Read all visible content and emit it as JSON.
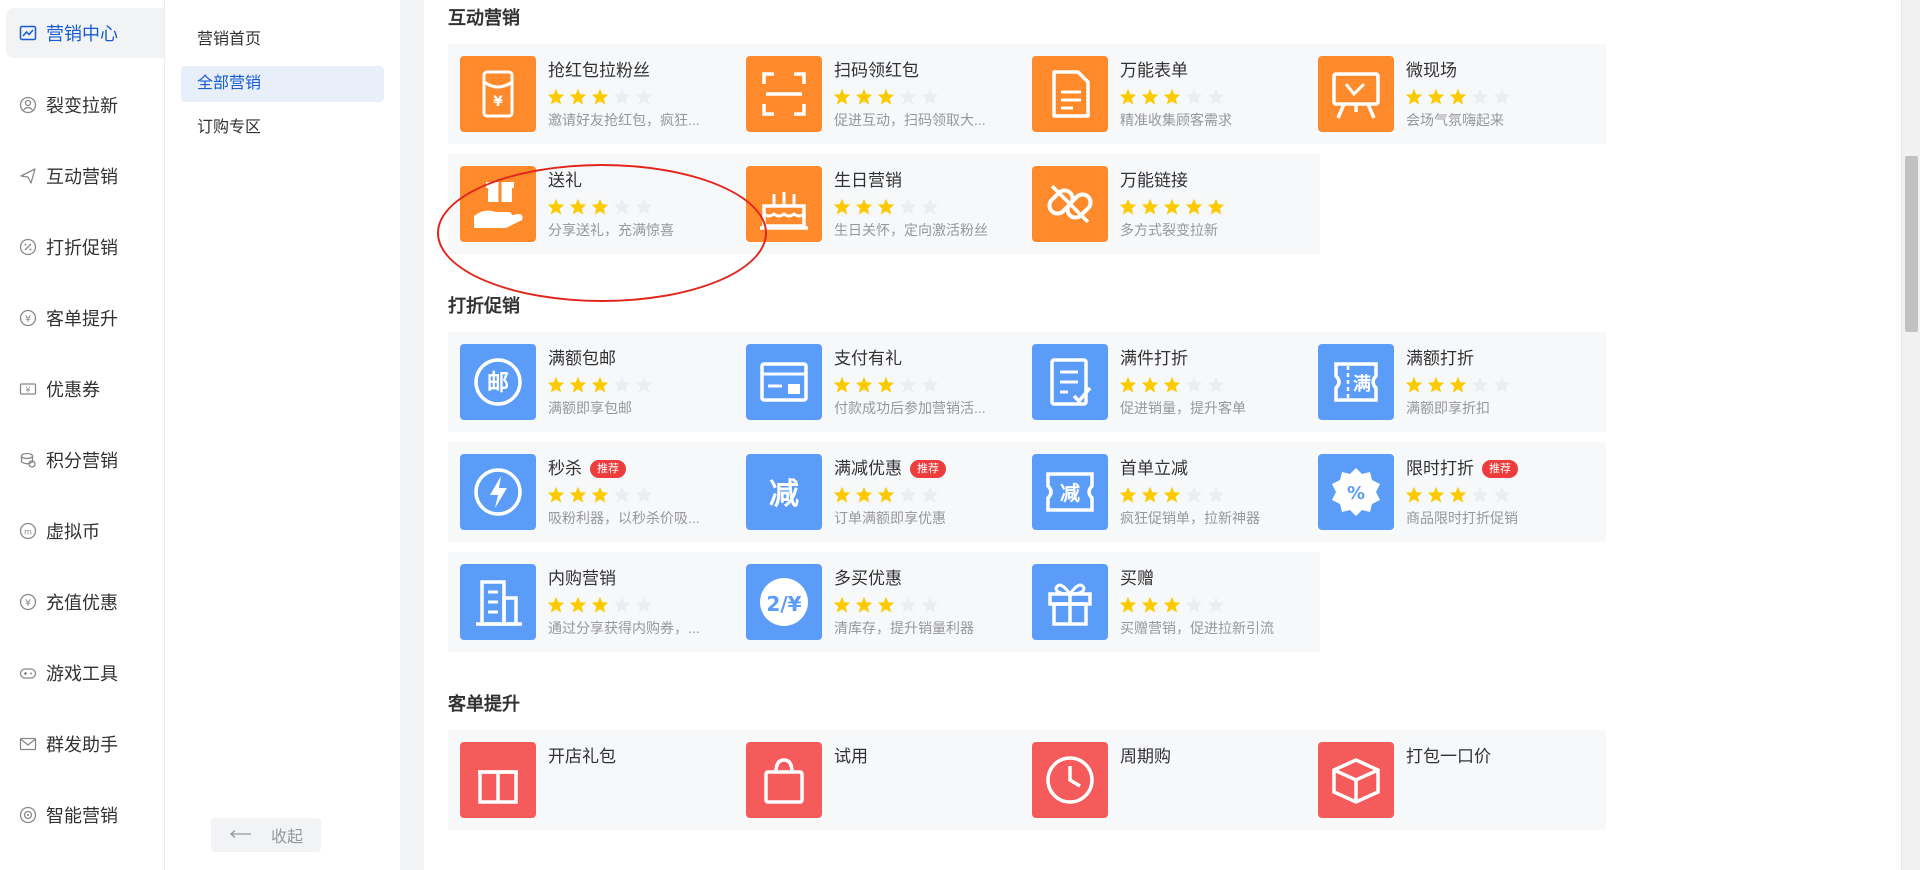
{
  "sidebar_primary": [
    {
      "label": "营销中心",
      "icon": "chart-line-icon",
      "active": true
    },
    {
      "label": "裂变拉新",
      "icon": "user-growth-icon"
    },
    {
      "label": "互动营销",
      "icon": "paper-plane-icon"
    },
    {
      "label": "打折促销",
      "icon": "discount-icon"
    },
    {
      "label": "客单提升",
      "icon": "yen-up-icon"
    },
    {
      "label": "优惠券",
      "icon": "coupon-icon"
    },
    {
      "label": "积分营销",
      "icon": "coins-icon"
    },
    {
      "label": "虚拟币",
      "icon": "virtual-coin-icon"
    },
    {
      "label": "充值优惠",
      "icon": "recharge-icon"
    },
    {
      "label": "游戏工具",
      "icon": "gamepad-icon"
    },
    {
      "label": "群发助手",
      "icon": "mail-icon"
    },
    {
      "label": "智能营销",
      "icon": "target-icon"
    }
  ],
  "sidebar_secondary": {
    "items": [
      {
        "label": "营销首页"
      },
      {
        "label": "全部营销",
        "active": true
      },
      {
        "label": "订购专区"
      }
    ],
    "collapse_label": "收起"
  },
  "sections": [
    {
      "title": "互动营销",
      "cards": [
        {
          "name": "抢红包拉粉丝",
          "stars": 3,
          "desc": "邀请好友抢红包，疯狂...",
          "icon": "red-envelope-icon",
          "color": "orange"
        },
        {
          "name": "扫码领红包",
          "stars": 3,
          "desc": "促进互动，扫码领取大...",
          "icon": "scan-code-icon",
          "color": "orange"
        },
        {
          "name": "万能表单",
          "stars": 3,
          "desc": "精准收集顾客需求",
          "icon": "form-document-icon",
          "color": "orange"
        },
        {
          "name": "微现场",
          "stars": 3,
          "desc": "会场气氛嗨起来",
          "icon": "presentation-board-icon",
          "color": "orange"
        },
        {
          "name": "送礼",
          "stars": 3,
          "desc": "分享送礼，充满惊喜",
          "icon": "gift-hand-icon",
          "color": "orange"
        },
        {
          "name": "生日营销",
          "stars": 3,
          "desc": "生日关怀，定向激活粉丝",
          "icon": "birthday-cake-icon",
          "color": "orange"
        },
        {
          "name": "万能链接",
          "stars": 5,
          "desc": "多方式裂变拉新",
          "icon": "link-icon",
          "color": "orange"
        }
      ]
    },
    {
      "title": "打折促销",
      "cards": [
        {
          "name": "满额包邮",
          "stars": 3,
          "desc": "满额即享包邮",
          "icon": "mail-stamp-icon",
          "glyph": "邮",
          "color": "blue"
        },
        {
          "name": "支付有礼",
          "stars": 3,
          "desc": "付款成功后参加营销活...",
          "icon": "payment-gift-icon",
          "color": "blue"
        },
        {
          "name": "满件打折",
          "stars": 3,
          "desc": "促进销量，提升客单",
          "icon": "checklist-icon",
          "color": "blue"
        },
        {
          "name": "满额打折",
          "stars": 3,
          "desc": "满额即享折扣",
          "icon": "ticket-icon",
          "glyph": "满",
          "color": "blue"
        },
        {
          "name": "秒杀",
          "badge": "推荐",
          "stars": 3,
          "desc": "吸粉利器，以秒杀价吸...",
          "icon": "lightning-icon",
          "color": "blue"
        },
        {
          "name": "满减优惠",
          "badge": "推荐",
          "stars": 3,
          "desc": "订单满额即享优惠",
          "icon": "reduce-icon",
          "glyph": "减",
          "color": "blue"
        },
        {
          "name": "首单立减",
          "stars": 3,
          "desc": "疯狂促销单，拉新神器",
          "icon": "reduce-ticket-icon",
          "glyph": "减",
          "color": "blue"
        },
        {
          "name": "限时打折",
          "badge": "推荐",
          "stars": 3,
          "desc": "商品限时打折促销",
          "icon": "percent-badge-icon",
          "glyph": "%",
          "color": "blue"
        },
        {
          "name": "内购营销",
          "stars": 3,
          "desc": "通过分享获得内购券，...",
          "icon": "building-icon",
          "color": "blue"
        },
        {
          "name": "多买优惠",
          "stars": 3,
          "desc": "清库存，提升销量利器",
          "icon": "multi-buy-icon",
          "glyph": "2/¥",
          "color": "blue"
        },
        {
          "name": "买赠",
          "stars": 3,
          "desc": "买赠营销，促进拉新引流",
          "icon": "gift-box-icon",
          "color": "blue"
        }
      ]
    },
    {
      "title": "客单提升",
      "cards": [
        {
          "name": "开店礼包",
          "icon": "gift-icon",
          "color": "red"
        },
        {
          "name": "试用",
          "icon": "shopping-bag-icon",
          "color": "red"
        },
        {
          "name": "周期购",
          "icon": "clock-icon",
          "color": "red"
        },
        {
          "name": "打包一口价",
          "icon": "package-icon",
          "color": "red"
        }
      ]
    }
  ],
  "colors": {
    "accent": "#155bd4",
    "orange": "#ff8a2b",
    "blue": "#5b9cf9",
    "red": "#f55b5b",
    "star_on": "#fcca00",
    "star_off": "#ebedf0",
    "badge": "#ee3b3b",
    "highlight": "#e1251b"
  }
}
